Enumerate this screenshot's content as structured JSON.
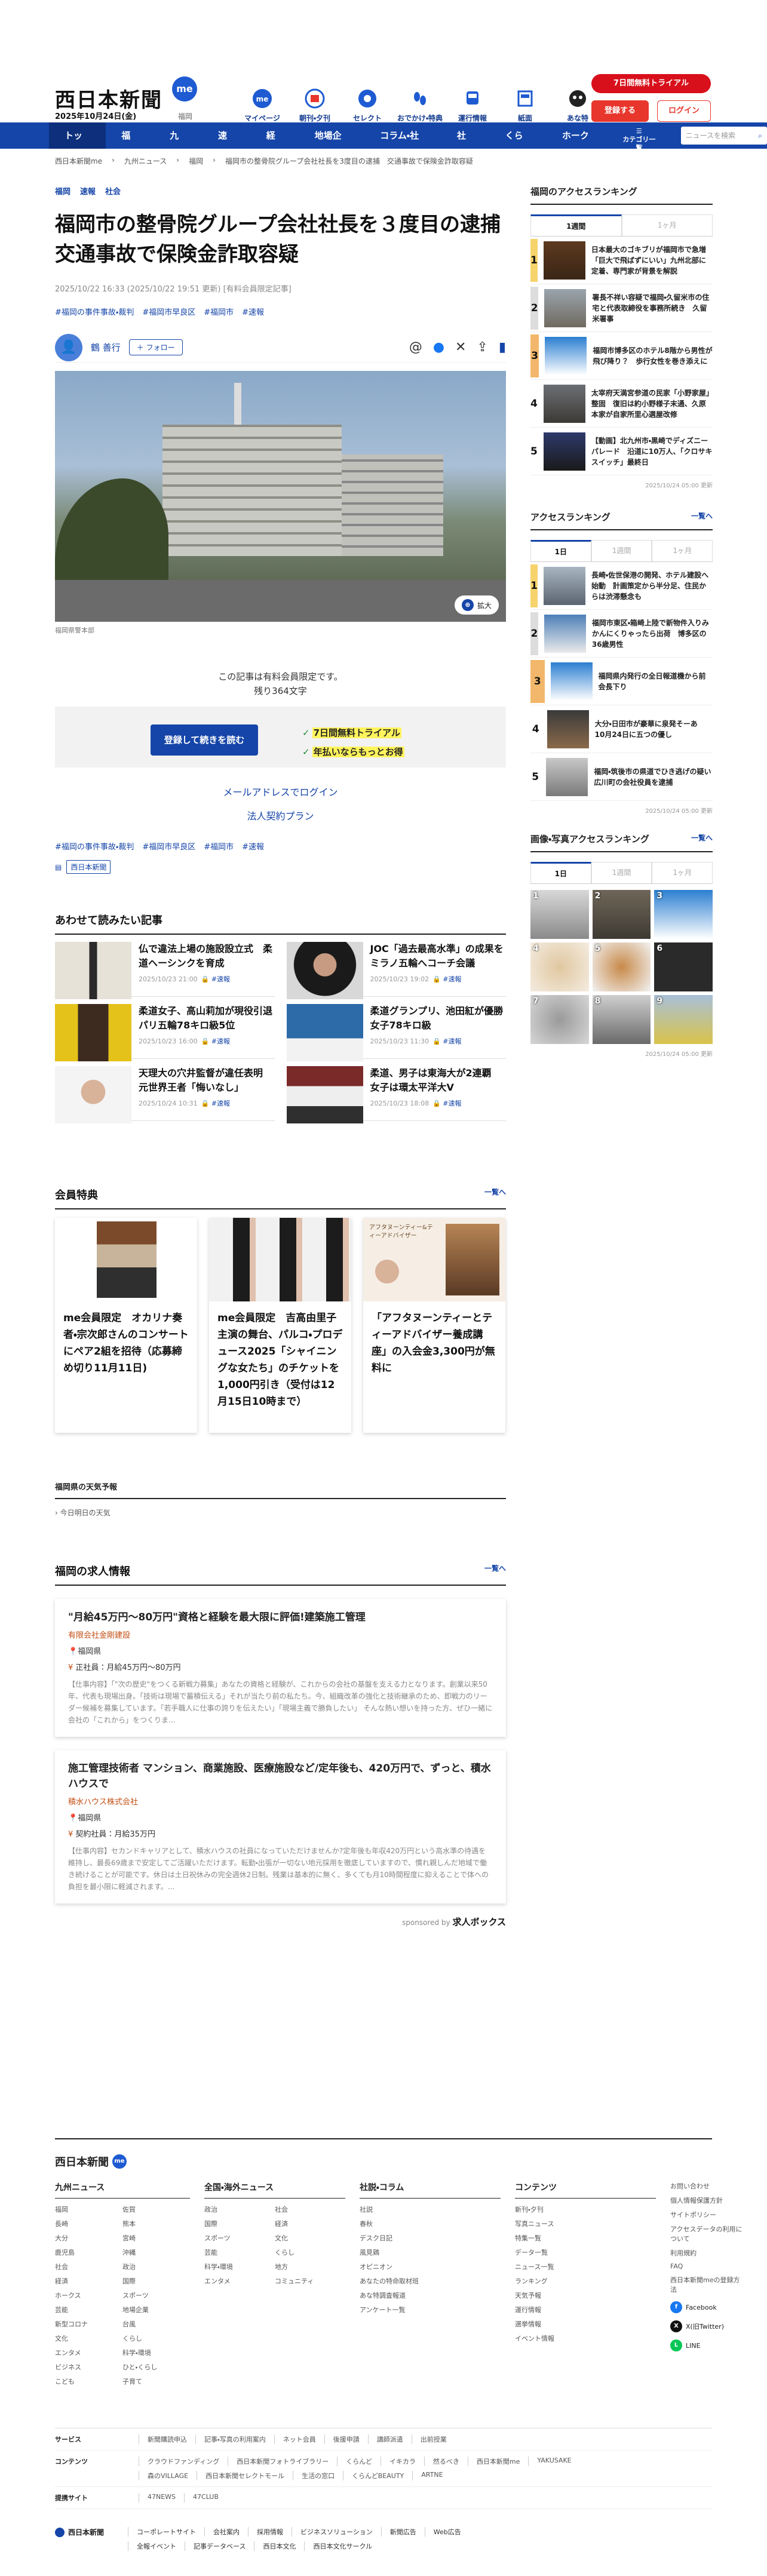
{
  "header": {
    "logo": "西日本新聞",
    "logo_badge": "me",
    "date": "2025年10月24日(金)",
    "pref": "福岡",
    "nav_icons": [
      {
        "label": "マイページ",
        "icon": "me-icon"
      },
      {
        "label": "朝刊・夕刊",
        "icon": "newspaper-icon"
      },
      {
        "label": "セレクト",
        "icon": "select-icon"
      },
      {
        "label": "おでかけ・特典",
        "icon": "outing-icon"
      },
      {
        "label": "運行情報",
        "icon": "train-icon"
      },
      {
        "label": "紙面",
        "icon": "paper-icon"
      },
      {
        "label": "あな特",
        "icon": "anatoku-icon"
      }
    ],
    "trial_label": "7日間無料トライアル",
    "register_label": "登録する",
    "login_label": "ログイン"
  },
  "gnav": {
    "items": [
      "トップ",
      "福岡",
      "九州",
      "速報",
      "経済",
      "地場企業",
      "コラム・社説",
      "社会",
      "くらし",
      "ホークス"
    ],
    "sub_label": "カテゴリ一覧",
    "search_placeholder": "ニュースを検索"
  },
  "breadcrumb": [
    "西日本新聞me",
    "九州ニュース",
    "福岡",
    "福岡市の整骨院グループ会社社長を3度目の逮捕　交通事故で保険金詐取容疑"
  ],
  "article": {
    "tags": [
      "福岡",
      "速報",
      "社会"
    ],
    "title": "福岡市の整骨院グループ会社社長を３度目の逮捕　交通事故で保険金詐取容疑",
    "meta": "2025/10/22 16:33 (2025/10/22 19:51 更新) [有料会員限定記事]",
    "hashtags": [
      "#福岡の事件事故・裁判",
      "#福岡市早良区",
      "#福岡市",
      "#速報"
    ],
    "author": "鶴 善行",
    "follow_label": "＋ フォロー",
    "zoom_label": "拡大",
    "caption": "福岡県警本部",
    "paywall_line1": "この記事は有料会員限定です。",
    "paywall_line2": "残り364文字",
    "pay_button": "登録して続きを読む",
    "pay_point1": "7日間無料トライアル",
    "pay_point2": "年払いならもっとお得",
    "mail_login": "メールアドレスでログイン",
    "corp_plan": "法人契約プラン",
    "hashtags2": [
      "#福岡の事件事故・裁判",
      "#福岡市早良区",
      "#福岡市",
      "#速報"
    ],
    "source_tag": "西日本新聞"
  },
  "related": {
    "heading": "あわせて読みたい記事",
    "items": [
      {
        "title": "仏で違法上場の施設設立式　柔道ヘーシンクを育成",
        "date": "2025/10/23 21:00",
        "badge": "速報"
      },
      {
        "title": "JOC「過去最高水準」の成果を　ミラノ五輪へコーチ会議",
        "date": "2025/10/23 19:02",
        "badge": "速報"
      },
      {
        "title": "柔道女子、高山莉加が現役引退　パリ五輪78キロ級5位",
        "date": "2025/10/23 16:00",
        "badge": "速報"
      },
      {
        "title": "柔道グランプリ、池田紅が優勝　女子78キロ級",
        "date": "2025/10/23 11:30",
        "badge": "速報"
      },
      {
        "title": "天理大の穴井監督が違任表明　元世界王者「悔いなし」",
        "date": "2025/10/24 10:31",
        "badge": "速報"
      },
      {
        "title": "柔道、男子は東海大が2連覇　女子は環太平洋大V",
        "date": "2025/10/23 18:08",
        "badge": "速報"
      }
    ]
  },
  "perks": {
    "heading": "会員特典",
    "more": "一覧へ",
    "items": [
      {
        "title": "me会員限定　オカリナ奏者・宗次郎さんのコンサートにペア2組を招待（応募締め切り11月11日)"
      },
      {
        "title": "me会員限定　吉高由里子主演の舞台、パルコ・プロデュース2025「シャイニングな女たち」のチケットを1,000円引き（受付は12月15日10時まで）"
      },
      {
        "title": "「アフタヌーンティーとティーアドバイザー養成講座」の入会金3,300円が無料に"
      }
    ],
    "card_badge_text": "アフタヌーンティー&ティーアドバイザー"
  },
  "weather": {
    "heading": "福岡県の天気予報",
    "item": "今日明日の天気"
  },
  "jobs": {
    "heading": "福岡の求人情報",
    "more": "一覧へ",
    "items": [
      {
        "title": "\"月給45万円〜80万円\"資格と経験を最大限に評価!建築施工管理",
        "company": "有限会社金剛建設",
        "location": "福岡県",
        "pay": "正社員：月給45万円〜80万円",
        "desc": "【仕事内容】「\"次の歴史\"をつくる新戦力募集」あなたの資格と経験が、これからの会社の基盤を支える力となります。創業以来50年、代表も現場出身。「技術は現場で蓄積伝える」それが当たり前の私たち。今、組織改革の強化と技術継承のため、即戦力のリーダー候補を募集しています。「若手職人に仕事の誇りを伝えたい」「現場主義で勝負したい」 そんな熱い想いを持った方、ぜひ一緒に会社の「これから」をつくりま..."
      },
      {
        "title": "施工管理技術者 マンション、商業施設、医療施設など/定年後も、420万円で、ずっと、積水ハウスで",
        "company": "積水ハウス株式会社",
        "location": "福岡県",
        "pay": "契約社員：月給35万円",
        "desc": "【仕事内容】セカンドキャリアとして、積水ハウスの社員になっていただけませんか?定年後も年収420万円という高水準の待遇を維持し、最長69歳まで安定してご活躍いただけます。転勤・出張が一切ない地元採用を徹底していますので、慣れ親しんだ地域で働き続けることが可能です。休日は土日祝休みの完全週休2日制。残業は基本的に無く、多くても月10時間程度に抑えることで体への負担を最小限に軽減されます。..."
      }
    ],
    "sponsor_prefix": "sponsored by",
    "sponsor": "求人ボックス"
  },
  "sidebar": {
    "access_fukuoka": {
      "heading": "福岡のアクセスランキング",
      "tabs": [
        "1週間",
        "1ヶ月"
      ],
      "items": [
        {
          "rank": "1",
          "title": "日本最大のゴキブリが福岡市で急増「巨大で飛ばずにいい」九州北部に定着、専門家が背景を解説"
        },
        {
          "rank": "2",
          "title": "署長不祥い容疑で福岡・久留米市の住宅と代表取締役を事務所続き　久留米署事"
        },
        {
          "rank": "3",
          "title": "福岡市博多区のホテル8階から男性が飛び降り？　歩行女性を巻き添えに"
        },
        {
          "rank": "4",
          "title": "太宰府天満宮参道の民家「小野家屋」整固　復旧は約小野様子末通、久原本家が自家所里心選屋改修"
        },
        {
          "rank": "5",
          "title": "【動画】北九州市・黒崎でディズニーパレード　沿道に10万人、「クロサキスイッチ」最終日"
        }
      ],
      "updated": "2025/10/24 05:00 更新"
    },
    "access_all": {
      "heading": "アクセスランキング",
      "more": "一覧へ",
      "tabs": [
        "1日",
        "1週間",
        "1ヶ月"
      ],
      "items": [
        {
          "rank": "1",
          "title": "長崎・佐世保港の開発、ホテル建設へ始動　計画策定から半分足、住民からは渋滞懸念も"
        },
        {
          "rank": "2",
          "title": "福岡市東区・箱崎上陸で新物件入りみかんにくりゃったら出荷　博多区の36歳男性"
        },
        {
          "rank": "3",
          "title": "福岡県内発行の全日報道機から前会長下り"
        },
        {
          "rank": "4",
          "title": "大分・日田市が豪華に泉発そーあ　10月24日に五つの優し"
        },
        {
          "rank": "5",
          "title": "福岡・筑後市の県道でひき逃げの疑い　広川町の会社役員を逮捕"
        }
      ],
      "updated": "2025/10/24 05:00 更新"
    },
    "image_ranking": {
      "heading": "画像・写真アクセスランキング",
      "more": "一覧へ",
      "tabs": [
        "1日",
        "1週間",
        "1ヶ月"
      ],
      "cells": [
        "1",
        "2",
        "3",
        "4",
        "5",
        "6",
        "7",
        "8",
        "9"
      ],
      "updated": "2025/10/24 05:00 更新"
    }
  },
  "footer": {
    "logo": "西日本新聞",
    "cols": [
      {
        "title": "九州ニュース",
        "links": [
          "福岡",
          "佐賀",
          "長崎",
          "熊本",
          "大分",
          "宮崎",
          "鹿児島",
          "沖縄",
          "社会",
          "政治",
          "経済",
          "国際",
          "ホークス",
          "スポーツ",
          "芸能",
          "地場企業",
          "新型コロナ",
          "台風",
          "文化",
          "くらし",
          "エンタメ",
          "科学・環境",
          "ビジネス",
          "ひと・くらし",
          "こども",
          "子育て"
        ]
      },
      {
        "title": "全国・海外ニュース",
        "links": [
          "政治",
          "社会",
          "国際",
          "経済",
          "スポーツ",
          "文化",
          "芸能",
          "くらし",
          "科学・環境",
          "地方",
          "エンタメ",
          "コミュニティ"
        ]
      },
      {
        "title": "社説・コラム",
        "links": [
          "社説",
          "春秋",
          "デスク日記",
          "風見鶏",
          "オピニオン",
          "あなたの特命取材班",
          "あな特調査報道",
          "アンケート一覧"
        ]
      },
      {
        "title": "コンテンツ",
        "links": [
          "新刊・夕刊",
          "写真ニュース",
          "特集一覧",
          "データ一覧",
          "ニュース一覧",
          "ランキング",
          "天気予報",
          "運行情報",
          "選挙情報",
          "イベント情報"
        ]
      },
      {
        "title": "",
        "links": [
          "お問い合わせ",
          "個人情報保護方針",
          "サイトポリシー",
          "アクセスデータの利用について",
          "利用規約",
          "FAQ",
          "西日本新聞meの登録方法"
        ]
      }
    ],
    "sns": [
      "Facebook",
      "X(旧Twitter)",
      "LINE"
    ],
    "rows": [
      {
        "k": "サービス",
        "v": [
          "新聞購読申込",
          "記事・写真の利用案内",
          "ネット会員",
          "後援申請",
          "講師派遣",
          "出前授業"
        ]
      },
      {
        "k": "コンテンツ",
        "v": [
          "クラウドファンディング",
          "西日本新聞フォトライブラリー",
          "くらんど",
          "イキカラ",
          "然るべき",
          "西日本新聞me",
          "YAKUSAKE",
          "森のVILLAGE",
          "西日本新聞セレクトモール",
          "生活の窓口",
          "くらんどBEAUTY",
          "ARTNE"
        ]
      },
      {
        "k": "提携サイト",
        "v": [
          "47NEWS",
          "47CLUB"
        ]
      }
    ],
    "corp": "西日本新聞",
    "corp_links": [
      "コーポレートサイト",
      "会社案内",
      "採用情報",
      "ビジネスソリューション",
      "新聞広告",
      "Web広告",
      "全報イベント",
      "記事データベース",
      "西日本文化",
      "西日本文化サークル"
    ]
  }
}
